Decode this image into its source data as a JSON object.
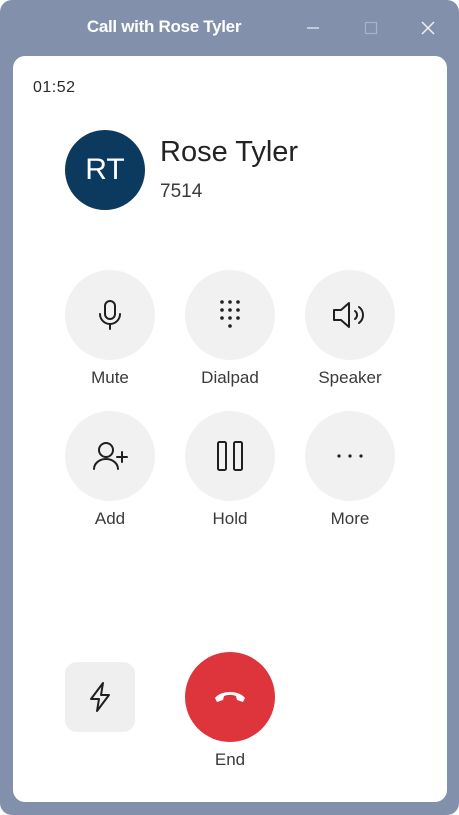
{
  "window": {
    "title": "Call with Rose Tyler"
  },
  "call": {
    "timer": "01:52",
    "avatar_initials": "RT",
    "contact_name": "Rose Tyler",
    "contact_number": "7514"
  },
  "controls": [
    {
      "label": "Mute",
      "icon": "microphone-icon"
    },
    {
      "label": "Dialpad",
      "icon": "dialpad-icon"
    },
    {
      "label": "Speaker",
      "icon": "speaker-icon"
    },
    {
      "label": "Add",
      "icon": "add-person-icon"
    },
    {
      "label": "Hold",
      "icon": "pause-icon"
    },
    {
      "label": "More",
      "icon": "more-icon"
    }
  ],
  "end_label": "End",
  "colors": {
    "titlebar": "#8290ab",
    "avatar": "#0c3a5e",
    "end_button": "#de343c"
  }
}
